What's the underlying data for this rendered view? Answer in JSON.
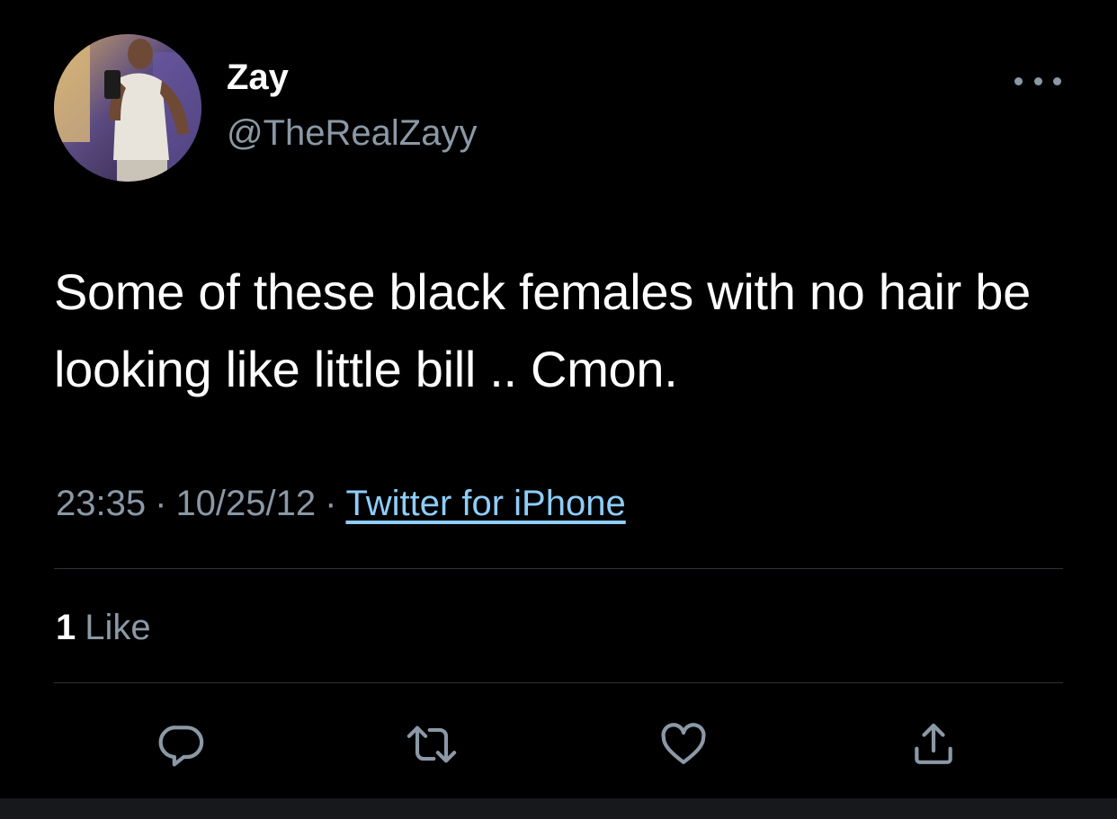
{
  "tweet": {
    "display_name": "Zay",
    "handle": "@TheRealZayy",
    "text": "Some of these black females with no hair be looking like little bill .. Cmon.",
    "time": "23:35",
    "date": "10/25/12",
    "separator": "·",
    "source": "Twitter for iPhone",
    "likes_count": "1",
    "likes_label": "Like"
  },
  "icons": {
    "more": "more-horizontal-icon",
    "reply": "reply-icon",
    "retweet": "retweet-icon",
    "like": "heart-icon",
    "share": "share-icon"
  },
  "colors": {
    "background": "#000000",
    "primary_text": "#ffffff",
    "secondary_text": "#8b98a5",
    "link": "#8ecdf8",
    "divider": "#2f3336"
  }
}
